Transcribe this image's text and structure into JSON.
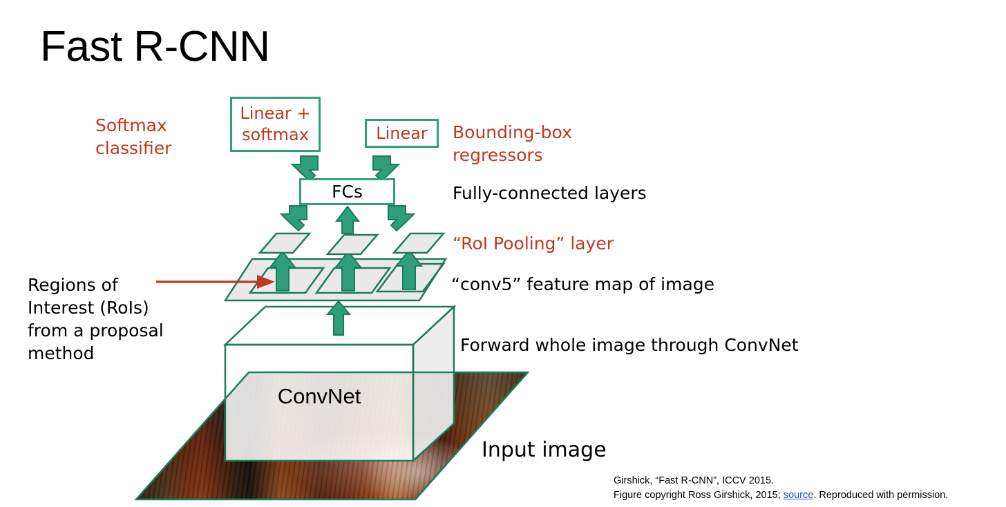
{
  "slide": {
    "title": "Fast R-CNN",
    "background_color": "#ffffff"
  },
  "colors": {
    "accent_red": "#c0391f",
    "accent_green": "#2e9e7b",
    "shape_fill": "#e8e8e8",
    "text_black": "#000000",
    "link_blue": "#1a4fd0"
  },
  "boxes": {
    "linear_softmax": "Linear +\nsoftmax",
    "linear_softmax_line1": "Linear +",
    "linear_softmax_line2": "softmax",
    "linear": "Linear",
    "fcs": "FCs",
    "convnet": "ConvNet"
  },
  "labels": {
    "softmax_classifier": "Softmax classifier",
    "softmax_classifier_line1": "Softmax",
    "softmax_classifier_line2": "classifier",
    "bbox_regressors": "Bounding-box regressors",
    "bbox_regressors_line1": "Bounding-box",
    "bbox_regressors_line2": "regressors",
    "fully_connected_layers": "Fully-connected layers",
    "roi_pooling_layer": "“RoI Pooling” layer",
    "conv5_feature_map": "“conv5” feature map of image",
    "rois_description": "Regions of Interest (RoIs) from a proposal method",
    "rois_line1": "Regions of",
    "rois_line2": "Interest (RoIs)",
    "rois_line3": "from a proposal",
    "rois_line4": "method",
    "forward_whole_image": "Forward whole image through ConvNet",
    "input_image": "Input image"
  },
  "citation": {
    "line1": "Girshick, “Fast R-CNN”, ICCV 2015.",
    "line2_prefix": "Figure copyright Ross Girshick, 2015; ",
    "link_text": "source",
    "line2_suffix": ". Reproduced with permission."
  },
  "diagram": {
    "arrows": [
      {
        "name": "arrow-fcs-to-linear-softmax",
        "direction": "up-left"
      },
      {
        "name": "arrow-fcs-to-linear",
        "direction": "up-right"
      },
      {
        "name": "arrow-roi1-to-fcs",
        "direction": "up-left"
      },
      {
        "name": "arrow-roi2-to-fcs",
        "direction": "up"
      },
      {
        "name": "arrow-roi3-to-fcs",
        "direction": "up-right"
      },
      {
        "name": "arrow-conv5-roi1-up",
        "direction": "up"
      },
      {
        "name": "arrow-conv5-roi2-up",
        "direction": "up"
      },
      {
        "name": "arrow-conv5-roi3-up",
        "direction": "up"
      },
      {
        "name": "arrow-convnet-to-conv5",
        "direction": "up"
      }
    ],
    "roi_pooled_maps": 3,
    "conv5_rois": 3,
    "pointer_arrow": {
      "name": "rois-pointer-arrow",
      "color": "#c0391f",
      "direction": "right"
    }
  }
}
